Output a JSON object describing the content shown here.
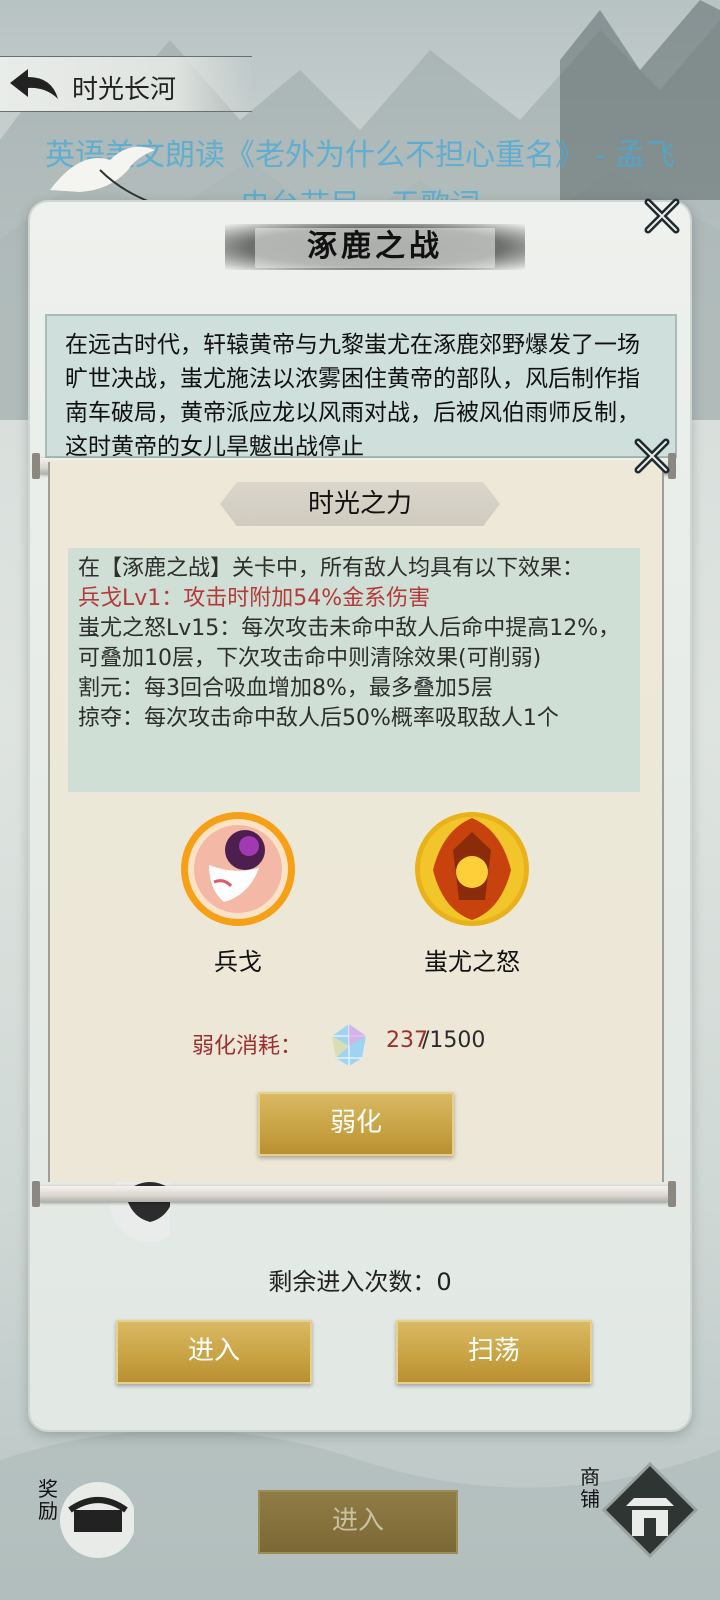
{
  "header": {
    "back_title": "时光长河"
  },
  "marquee": {
    "line1": "英语美文朗读《老外为什么不担心重名》 - 孟飞",
    "line2": "电台节目，无歌词"
  },
  "outer_dialog": {
    "title": "涿鹿之战",
    "story": "在远古时代，轩辕黄帝与九黎蚩尤在涿鹿郊野爆发了一场旷世决战，蚩尤施法以浓雾困住黄帝的部队，风后制作指南车破局，黄帝派应龙以风雨对战，后被风伯雨师反制，这时黄帝的女儿旱魃出战停止",
    "remaining_label": "剩余进入次数：",
    "remaining_count": "0",
    "enter_button": "进入",
    "sweep_button": "扫荡"
  },
  "power_panel": {
    "title": "时光之力",
    "effects": [
      {
        "text": "在【涿鹿之战】关卡中，所有敌人均具有以下效果：",
        "color": "#2e2e2e"
      },
      {
        "text": "兵戈Lv1：攻击时附加54%金系伤害",
        "color": "#b33a3a"
      },
      {
        "text": "蚩尤之怒Lv15：每次攻击未命中敌人后命中提高12%，可叠加10层，下次攻击命中则清除效果(可削弱)",
        "color": "#2e2e2e"
      },
      {
        "text": "割元：每3回合吸血增加8%，最多叠加5层",
        "color": "#2e2e2e"
      },
      {
        "text": "掠夺：每次攻击命中敌人后50%概率吸取敌人1个",
        "color": "#2e2e2e"
      }
    ],
    "skills": [
      {
        "name": "兵戈",
        "icon": "weapon-skill-icon"
      },
      {
        "name": "蚩尤之怒",
        "icon": "chiyou-rage-icon"
      }
    ],
    "cost": {
      "label": "弱化消耗：",
      "icon": "crystal-gem-icon",
      "current": "237",
      "max": "/1500"
    },
    "weaken_button": "弱化"
  },
  "bottom_bar": {
    "reward_label": "奖励",
    "shop_label": "商铺",
    "enter_button": "进入"
  },
  "colors": {
    "gold_button": "#c9a445",
    "cost_red": "#9c2f2f",
    "effect_red": "#b33a3a",
    "marquee_blue": "#46aad7"
  }
}
